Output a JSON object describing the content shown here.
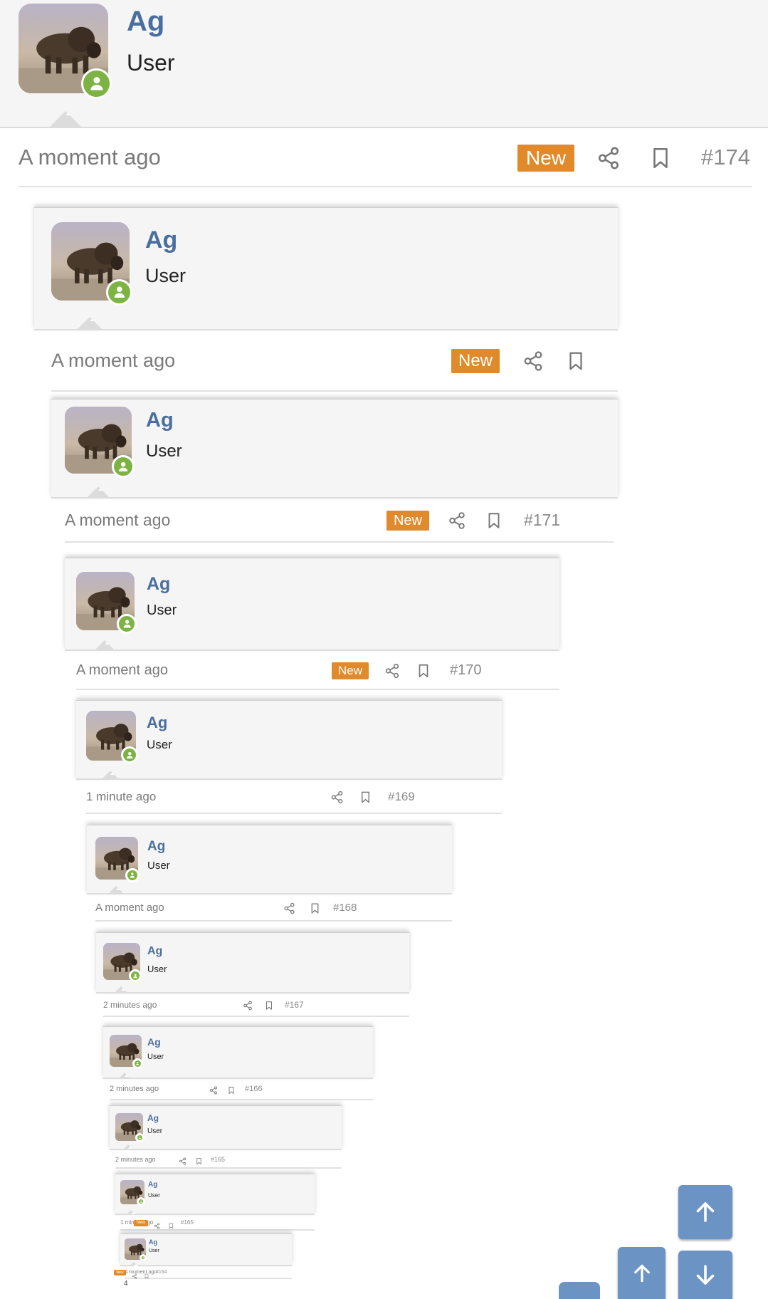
{
  "posts": [
    {
      "username": "Ag",
      "role": "User",
      "time": "A moment ago",
      "is_new": true,
      "new_label": "New",
      "number": "#174"
    },
    {
      "username": "Ag",
      "role": "User",
      "time": "A moment ago",
      "is_new": true,
      "new_label": "New",
      "number": ""
    },
    {
      "username": "Ag",
      "role": "User",
      "time": "A moment ago",
      "is_new": true,
      "new_label": "New",
      "number": "#171"
    },
    {
      "username": "Ag",
      "role": "User",
      "time": "A moment ago",
      "is_new": true,
      "new_label": "New",
      "number": "#170"
    },
    {
      "username": "Ag",
      "role": "User",
      "time": "1 minute ago",
      "is_new": false,
      "new_label": "",
      "number": "#169"
    },
    {
      "username": "Ag",
      "role": "User",
      "time": "A moment ago",
      "is_new": false,
      "new_label": "",
      "number": "#168"
    },
    {
      "username": "Ag",
      "role": "User",
      "time": "2 minutes ago",
      "is_new": false,
      "new_label": "",
      "number": "#167"
    },
    {
      "username": "Ag",
      "role": "User",
      "time": "2 minutes ago",
      "is_new": false,
      "new_label": "",
      "number": "#166"
    },
    {
      "username": "Ag",
      "role": "User",
      "time": "2 minutes ago",
      "is_new": false,
      "new_label": "",
      "number": "#165"
    },
    {
      "username": "Ag",
      "role": "User",
      "time": "1 minute ago",
      "is_new": true,
      "new_label": "New",
      "number": "#165"
    },
    {
      "username": "Ag",
      "role": "User",
      "time": "A moment ago",
      "is_new": true,
      "new_label": "New",
      "number": "#164"
    }
  ],
  "page_count": "4",
  "icons": {
    "avatar": "bison-photo",
    "online_badge": "user-icon",
    "share": "share-icon",
    "bookmark": "bookmark-icon",
    "scroll_up": "arrow-up-icon",
    "scroll_down": "arrow-down-icon"
  },
  "colors": {
    "username": "#4a6f9f",
    "new_badge": "#e08a2c",
    "online_badge": "#7cb342",
    "scroll_button": "#6b93c4"
  }
}
